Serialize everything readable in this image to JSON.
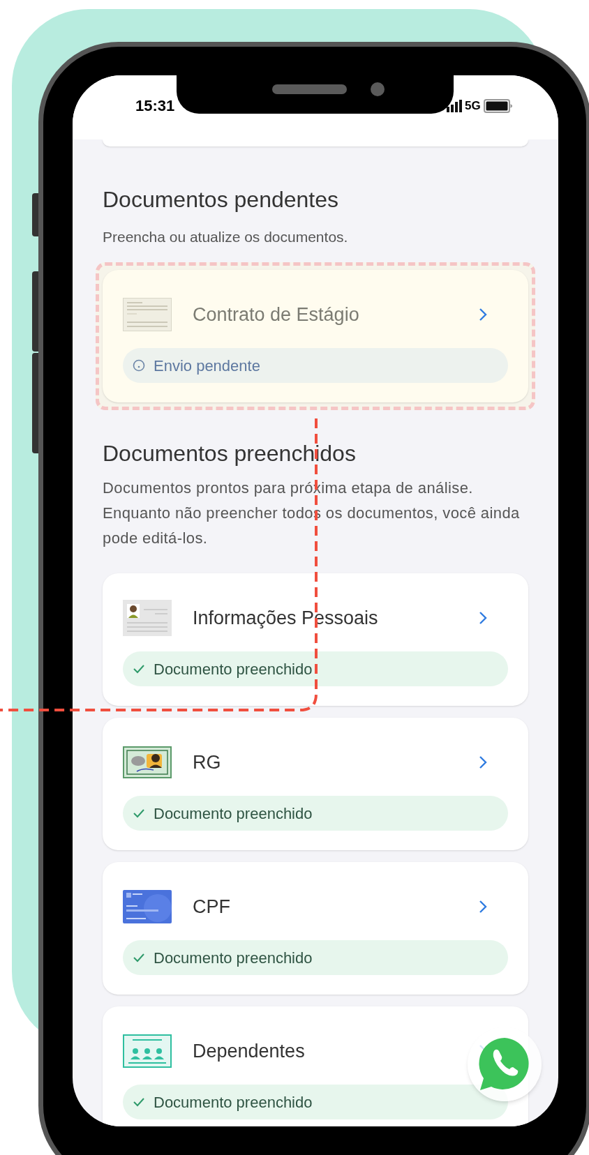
{
  "status_bar": {
    "time": "15:31",
    "network": "5G"
  },
  "sections": [
    {
      "title": "Documentos pendentes",
      "description": "Preencha ou atualize os documentos.",
      "highlighted": true,
      "documents": [
        {
          "kind": "contract",
          "title": "Contrato de Estágio",
          "pending": true,
          "status_text": "Envio pendente"
        }
      ]
    },
    {
      "title": "Documentos preenchidos",
      "description": "Documentos prontos para próxima etapa de análise. Enquanto não preencher todos os documentos, você ainda pode editá-los.",
      "highlighted": false,
      "documents": [
        {
          "kind": "profile",
          "title": "Informações Pessoais",
          "pending": false,
          "status_text": "Documento preenchido"
        },
        {
          "kind": "rg",
          "title": "RG",
          "pending": false,
          "status_text": "Documento preenchido"
        },
        {
          "kind": "cpf",
          "title": "CPF",
          "pending": false,
          "status_text": "Documento preenchido"
        },
        {
          "kind": "dependents",
          "title": "Dependentes",
          "pending": false,
          "status_text": "Documento preenchido"
        }
      ]
    }
  ]
}
